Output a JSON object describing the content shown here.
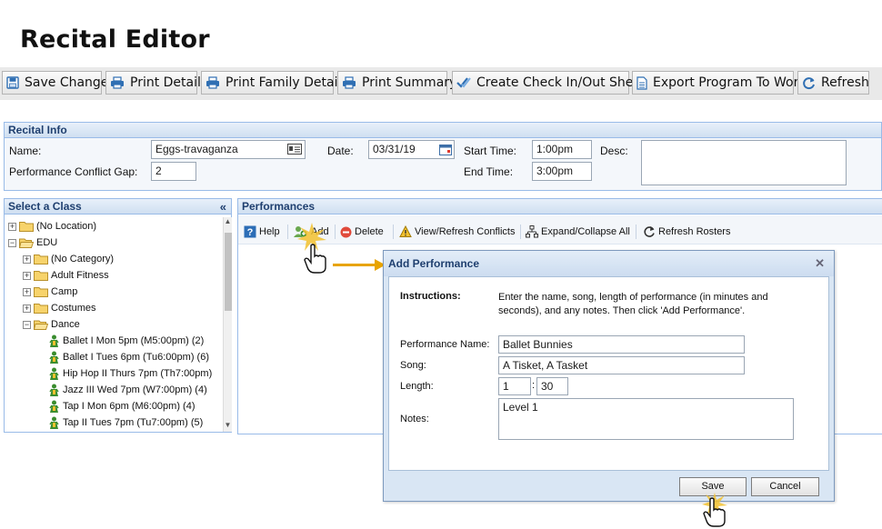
{
  "page_title": "Recital  Editor",
  "toolbar": {
    "buttons": [
      {
        "label": "Save Changes"
      },
      {
        "label": "Print Detail"
      },
      {
        "label": "Print Family Detail"
      },
      {
        "label": "Print Summary"
      },
      {
        "label": "Create Check In/Out Sheet"
      },
      {
        "label": "Export Program To Word"
      },
      {
        "label": "Refresh"
      }
    ]
  },
  "recital_info": {
    "title": "Recital Info",
    "name_label": "Name:",
    "name_value": "Eggs-travaganza",
    "date_label": "Date:",
    "date_value": "03/31/19",
    "start_label": "Start Time:",
    "start_value": "1:00pm",
    "end_label": "End Time:",
    "end_value": "3:00pm",
    "desc_label": "Desc:",
    "desc_value": "",
    "gap_label": "Performance Conflict Gap:",
    "gap_value": "2"
  },
  "class_panel": {
    "title": "Select a Class",
    "collapse_glyph": "«",
    "tree": [
      {
        "label": "(No Location)",
        "level": 0,
        "expander": "+",
        "kind": "folder"
      },
      {
        "label": "EDU",
        "level": 0,
        "expander": "−",
        "kind": "folder-open"
      },
      {
        "label": "(No Category)",
        "level": 1,
        "expander": "+",
        "kind": "folder"
      },
      {
        "label": "Adult Fitness",
        "level": 1,
        "expander": "+",
        "kind": "folder"
      },
      {
        "label": "Camp",
        "level": 1,
        "expander": "+",
        "kind": "folder"
      },
      {
        "label": "Costumes",
        "level": 1,
        "expander": "+",
        "kind": "folder"
      },
      {
        "label": "Dance",
        "level": 1,
        "expander": "−",
        "kind": "folder-open"
      },
      {
        "label": "Ballet I Mon 5pm (M5:00pm) (2)",
        "level": 2,
        "kind": "class"
      },
      {
        "label": "Ballet I Tues 6pm (Tu6:00pm) (6)",
        "level": 2,
        "kind": "class"
      },
      {
        "label": "Hip Hop II Thurs 7pm (Th7:00pm)",
        "level": 2,
        "kind": "class"
      },
      {
        "label": "Jazz III Wed 7pm (W7:00pm) (4)",
        "level": 2,
        "kind": "class"
      },
      {
        "label": "Tap I Mon 6pm (M6:00pm) (4)",
        "level": 2,
        "kind": "class"
      },
      {
        "label": "Tap II Tues 7pm (Tu7:00pm) (5)",
        "level": 2,
        "kind": "class"
      }
    ]
  },
  "performances": {
    "title": "Performances",
    "tools": [
      {
        "label": "Help"
      },
      {
        "label": "Add"
      },
      {
        "label": "Delete"
      },
      {
        "label": "View/Refresh Conflicts"
      },
      {
        "label": "Expand/Collapse All"
      },
      {
        "label": "Refresh Rosters"
      }
    ]
  },
  "dialog": {
    "title": "Add Performance",
    "instructions_label": "Instructions:",
    "instructions_text": "Enter the name, song, length of performance (in minutes and seconds), and any notes. Then click 'Add Performance'.",
    "perf_name_label": "Performance Name:",
    "perf_name_value": "Ballet Bunnies",
    "song_label": "Song:",
    "song_value": "A Tisket, A Tasket",
    "length_label": "Length:",
    "length_minutes": "1",
    "length_sep": ":",
    "length_seconds": "30",
    "notes_label": "Notes:",
    "notes_value": "Level 1",
    "save_label": "Save",
    "cancel_label": "Cancel",
    "close_glyph": "✕"
  },
  "colors": {
    "panel_border": "#99bbe8",
    "panel_header_text": "#1f3f6f",
    "highlight": "#e8a400"
  }
}
